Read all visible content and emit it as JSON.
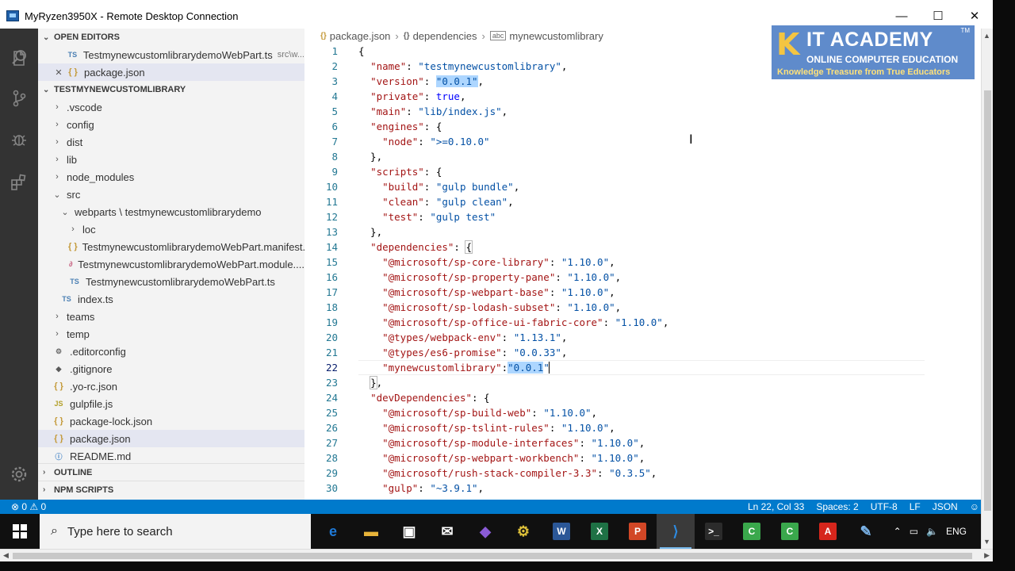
{
  "window": {
    "title": "MyRyzen3950X - Remote Desktop Connection",
    "minimize": "—",
    "maximize": "☐",
    "close": "✕"
  },
  "activity_bar": {
    "icons": [
      "files-icon",
      "search-icon",
      "source-control-icon",
      "debug-icon",
      "extensions-icon",
      "settings-gear-icon"
    ]
  },
  "sidebar": {
    "open_editors": {
      "title": "OPEN EDITORS",
      "items": [
        {
          "name": "TestmynewcustomlibrarydemoWebPart.ts",
          "desc": "src\\w...",
          "icon": "TS"
        },
        {
          "name": "package.json",
          "icon": "{ }",
          "close": "✕"
        }
      ]
    },
    "project": {
      "title": "TESTMYNEWCUSTOMLIBRARY",
      "items": [
        {
          "label": ".vscode",
          "kind": "folder",
          "open": false,
          "depth": 1
        },
        {
          "label": "config",
          "kind": "folder",
          "open": false,
          "depth": 1
        },
        {
          "label": "dist",
          "kind": "folder",
          "open": false,
          "depth": 1
        },
        {
          "label": "lib",
          "kind": "folder",
          "open": false,
          "depth": 1
        },
        {
          "label": "node_modules",
          "kind": "folder",
          "open": false,
          "depth": 1
        },
        {
          "label": "src",
          "kind": "folder",
          "open": true,
          "depth": 1
        },
        {
          "label": "webparts \\ testmynewcustomlibrarydemo",
          "kind": "folder",
          "open": true,
          "depth": 2
        },
        {
          "label": "loc",
          "kind": "folder",
          "open": false,
          "depth": 3
        },
        {
          "label": "TestmynewcustomlibrarydemoWebPart.manifest....",
          "kind": "json",
          "depth": 3
        },
        {
          "label": "TestmynewcustomlibrarydemoWebPart.module....",
          "kind": "scss",
          "depth": 3
        },
        {
          "label": "TestmynewcustomlibrarydemoWebPart.ts",
          "kind": "ts",
          "depth": 3
        },
        {
          "label": "index.ts",
          "kind": "ts",
          "depth": 2
        },
        {
          "label": "teams",
          "kind": "folder",
          "open": false,
          "depth": 1
        },
        {
          "label": "temp",
          "kind": "folder",
          "open": false,
          "depth": 1
        },
        {
          "label": ".editorconfig",
          "kind": "gear",
          "depth": 1
        },
        {
          "label": ".gitignore",
          "kind": "git",
          "depth": 1
        },
        {
          "label": ".yo-rc.json",
          "kind": "json",
          "depth": 1
        },
        {
          "label": "gulpfile.js",
          "kind": "js",
          "depth": 1
        },
        {
          "label": "package-lock.json",
          "kind": "json",
          "depth": 1
        },
        {
          "label": "package.json",
          "kind": "json",
          "depth": 1,
          "selected": true
        },
        {
          "label": "README.md",
          "kind": "info",
          "depth": 1
        }
      ]
    },
    "outline": "OUTLINE",
    "npm_scripts": "NPM SCRIPTS"
  },
  "breadcrumb": {
    "file": "package.json",
    "node": "dependencies",
    "leaf": "mynewcustomlibrary"
  },
  "editor": {
    "current_line": 22,
    "lines": [
      "{",
      "  \"name\": \"testmynewcustomlibrary\",",
      "  \"version\": \"0.0.1\",",
      "  \"private\": true,",
      "  \"main\": \"lib/index.js\",",
      "  \"engines\": {",
      "    \"node\": \">=0.10.0\"",
      "  },",
      "  \"scripts\": {",
      "    \"build\": \"gulp bundle\",",
      "    \"clean\": \"gulp clean\",",
      "    \"test\": \"gulp test\"",
      "  },",
      "  \"dependencies\": {",
      "    \"@microsoft/sp-core-library\": \"1.10.0\",",
      "    \"@microsoft/sp-property-pane\": \"1.10.0\",",
      "    \"@microsoft/sp-webpart-base\": \"1.10.0\",",
      "    \"@microsoft/sp-lodash-subset\": \"1.10.0\",",
      "    \"@microsoft/sp-office-ui-fabric-core\": \"1.10.0\",",
      "    \"@types/webpack-env\": \"1.13.1\",",
      "    \"@types/es6-promise\": \"0.0.33\",",
      "    \"mynewcustomlibrary\":\"0.0.1\"",
      "  },",
      "  \"devDependencies\": {",
      "    \"@microsoft/sp-build-web\": \"1.10.0\",",
      "    \"@microsoft/sp-tslint-rules\": \"1.10.0\",",
      "    \"@microsoft/sp-module-interfaces\": \"1.10.0\",",
      "    \"@microsoft/sp-webpart-workbench\": \"1.10.0\",",
      "    \"@microsoft/rush-stack-compiler-3.3\": \"0.3.5\",",
      "    \"gulp\": \"~3.9.1\","
    ]
  },
  "logo": {
    "letter": "K",
    "title": "IT ACADEMY",
    "subtitle": "ONLINE COMPUTER EDUCATION",
    "tagline": "Knowledge Treasure from True Educators",
    "tm": "TM"
  },
  "statusbar": {
    "problems": "⊗ 0 ⚠ 0",
    "position": "Ln 22, Col 33",
    "spaces": "Spaces: 2",
    "encoding": "UTF-8",
    "eol": "LF",
    "language": "JSON",
    "feedback": "☺"
  },
  "taskbar": {
    "search_placeholder": "Type here to search",
    "apps": [
      {
        "name": "edge-icon",
        "glyph": "e",
        "color": "#1f7ad8"
      },
      {
        "name": "file-explorer-icon",
        "glyph": "▬",
        "color": "#e8b43a"
      },
      {
        "name": "store-icon",
        "glyph": "▣",
        "color": "#ffffff"
      },
      {
        "name": "mail-icon",
        "glyph": "✉",
        "color": "#ffffff"
      },
      {
        "name": "visual-studio-icon",
        "glyph": "◆",
        "color": "#8a5bd6"
      },
      {
        "name": "network-tool-icon",
        "glyph": "⚙",
        "color": "#e0c23a"
      },
      {
        "name": "word-icon",
        "glyph": "W",
        "color": "#2b5797"
      },
      {
        "name": "excel-icon",
        "glyph": "X",
        "color": "#1e7145"
      },
      {
        "name": "powerpoint-icon",
        "glyph": "P",
        "color": "#d24726"
      },
      {
        "name": "vscode-icon",
        "glyph": "⟩",
        "color": "#2d8ae0",
        "active": true
      },
      {
        "name": "terminal-icon",
        "glyph": ">_",
        "color": "#2b2b2b"
      },
      {
        "name": "camtasia-icon",
        "glyph": "C",
        "color": "#3aa84c"
      },
      {
        "name": "camtasia-recorder-icon",
        "glyph": "C",
        "color": "#3aa84c"
      },
      {
        "name": "acrobat-icon",
        "glyph": "A",
        "color": "#d6261c"
      },
      {
        "name": "notes-icon",
        "glyph": "✎",
        "color": "#7ab3e8"
      }
    ],
    "language": "ENG"
  }
}
